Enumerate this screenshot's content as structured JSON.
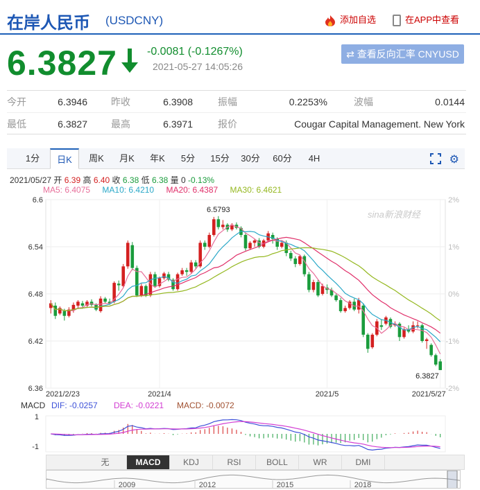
{
  "header": {
    "title": "在岸人民币",
    "code": "(USDCNY)",
    "fav_label": "添加自选",
    "app_label": "在APP中查看"
  },
  "quote": {
    "price": "6.3827",
    "change": "-0.0081 (-0.1267%)",
    "time": "2021-05-27 14:05:26",
    "reverse_label": "查看反向汇率 CNYUSD",
    "direction": "down"
  },
  "stats": {
    "row1": [
      {
        "label": "今开",
        "value": "6.3946"
      },
      {
        "label": "昨收",
        "value": "6.3908"
      },
      {
        "label": "振幅",
        "value": "0.2253%"
      },
      {
        "label": "波幅",
        "value": "0.0144"
      }
    ],
    "row2": [
      {
        "label": "最低",
        "value": "6.3827"
      },
      {
        "label": "最高",
        "value": "6.3971"
      },
      {
        "label": "报价",
        "value": "Cougar Capital Management. New York"
      }
    ]
  },
  "tabs": [
    "1分",
    "日K",
    "周K",
    "月K",
    "年K",
    "5分",
    "15分",
    "30分",
    "60分",
    "4H"
  ],
  "active_tab": "日K",
  "ohlc_line": {
    "date": "2021/05/27",
    "open_label": "开",
    "open": "6.39",
    "high_label": "高",
    "high": "6.40",
    "close_label": "收",
    "close": "6.38",
    "low_label": "低",
    "low": "6.38",
    "vol_label": "量",
    "vol": "0",
    "pct": "-0.13%"
  },
  "ma_line": {
    "ma5": "MA5: 6.4075",
    "ma10": "MA10: 6.4210",
    "ma20": "MA20: 6.4387",
    "ma30": "MA30: 6.4621"
  },
  "colors": {
    "up": "#d42020",
    "down": "#1a9c3c",
    "ma5": "#e86f9a",
    "ma10": "#2aa8c8",
    "ma20": "#e0306a",
    "ma30": "#95b820",
    "dif": "#3c50d8",
    "dea": "#d23cd2",
    "brand": "#1d57b4"
  },
  "watermark": "sina新浪财经",
  "chart_data": {
    "type": "candlestick",
    "y_ticks": [
      "6.6",
      "6.54",
      "6.48",
      "6.42",
      "6.36"
    ],
    "ylim": [
      6.36,
      6.6
    ],
    "pct_ticks": [
      "2%",
      "1%",
      "0%",
      "-1%",
      "-2%"
    ],
    "x_labels": [
      "2021/2/23",
      "2021/4",
      "2021/5",
      "2021/5/27"
    ],
    "max_label": "6.5793",
    "last_label": "6.3827",
    "candles": [
      [
        6.462,
        6.468,
        6.455,
        6.472
      ],
      [
        6.465,
        6.452,
        6.448,
        6.469
      ],
      [
        6.455,
        6.462,
        6.453,
        6.464
      ],
      [
        6.458,
        6.452,
        6.446,
        6.461
      ],
      [
        6.452,
        6.46,
        6.45,
        6.463
      ],
      [
        6.459,
        6.466,
        6.456,
        6.469
      ],
      [
        6.465,
        6.47,
        6.462,
        6.472
      ],
      [
        6.468,
        6.465,
        6.461,
        6.471
      ],
      [
        6.465,
        6.47,
        6.463,
        6.472
      ],
      [
        6.47,
        6.466,
        6.464,
        6.473
      ],
      [
        6.466,
        6.46,
        6.458,
        6.468
      ],
      [
        6.458,
        6.474,
        6.456,
        6.477
      ],
      [
        6.474,
        6.47,
        6.468,
        6.476
      ],
      [
        6.47,
        6.468,
        6.466,
        6.474
      ],
      [
        6.47,
        6.494,
        6.468,
        6.496
      ],
      [
        6.493,
        6.491,
        6.484,
        6.497
      ],
      [
        6.49,
        6.515,
        6.488,
        6.518
      ],
      [
        6.515,
        6.545,
        6.512,
        6.548
      ],
      [
        6.542,
        6.513,
        6.51,
        6.546
      ],
      [
        6.513,
        6.478,
        6.476,
        6.516
      ],
      [
        6.478,
        6.49,
        6.476,
        6.493
      ],
      [
        6.49,
        6.478,
        6.476,
        6.492
      ],
      [
        6.478,
        6.505,
        6.476,
        6.508
      ],
      [
        6.505,
        6.49,
        6.488,
        6.508
      ],
      [
        6.49,
        6.5,
        6.488,
        6.502
      ],
      [
        6.5,
        6.506,
        6.498,
        6.508
      ],
      [
        6.505,
        6.498,
        6.496,
        6.508
      ],
      [
        6.498,
        6.486,
        6.484,
        6.5
      ],
      [
        6.486,
        6.505,
        6.484,
        6.507
      ],
      [
        6.505,
        6.51,
        6.503,
        6.513
      ],
      [
        6.51,
        6.508,
        6.503,
        6.513
      ],
      [
        6.508,
        6.52,
        6.506,
        6.523
      ],
      [
        6.52,
        6.515,
        6.512,
        6.523
      ],
      [
        6.515,
        6.545,
        6.513,
        6.548
      ],
      [
        6.545,
        6.54,
        6.536,
        6.548
      ],
      [
        6.54,
        6.555,
        6.538,
        6.558
      ],
      [
        6.555,
        6.575,
        6.553,
        6.578
      ],
      [
        6.575,
        6.565,
        6.562,
        6.579
      ],
      [
        6.565,
        6.568,
        6.562,
        6.574
      ],
      [
        6.568,
        6.562,
        6.559,
        6.57
      ],
      [
        6.562,
        6.568,
        6.56,
        6.57
      ],
      [
        6.568,
        6.564,
        6.562,
        6.571
      ],
      [
        6.564,
        6.555,
        6.552,
        6.566
      ],
      [
        6.555,
        6.538,
        6.535,
        6.557
      ],
      [
        6.538,
        6.545,
        6.536,
        6.547
      ],
      [
        6.545,
        6.548,
        6.54,
        6.55
      ],
      [
        6.548,
        6.54,
        6.538,
        6.551
      ],
      [
        6.54,
        6.548,
        6.538,
        6.55
      ],
      [
        6.548,
        6.557,
        6.546,
        6.56
      ],
      [
        6.555,
        6.55,
        6.544,
        6.558
      ],
      [
        6.55,
        6.54,
        6.536,
        6.552
      ],
      [
        6.54,
        6.545,
        6.538,
        6.548
      ],
      [
        6.545,
        6.532,
        6.528,
        6.548
      ],
      [
        6.532,
        6.525,
        6.522,
        6.535
      ],
      [
        6.525,
        6.518,
        6.514,
        6.528
      ],
      [
        6.518,
        6.528,
        6.516,
        6.53
      ],
      [
        6.528,
        6.505,
        6.502,
        6.53
      ],
      [
        6.505,
        6.485,
        6.482,
        6.508
      ],
      [
        6.485,
        6.495,
        6.482,
        6.498
      ],
      [
        6.495,
        6.478,
        6.476,
        6.498
      ],
      [
        6.48,
        6.49,
        6.478,
        6.493
      ],
      [
        6.488,
        6.485,
        6.48,
        6.492
      ],
      [
        6.485,
        6.478,
        6.476,
        6.488
      ],
      [
        6.478,
        6.472,
        6.47,
        6.481
      ],
      [
        6.472,
        6.458,
        6.456,
        6.475
      ],
      [
        6.458,
        6.462,
        6.456,
        6.465
      ],
      [
        6.462,
        6.47,
        6.46,
        6.472
      ],
      [
        6.47,
        6.46,
        6.458,
        6.474
      ],
      [
        6.46,
        6.472,
        6.455,
        6.475
      ],
      [
        6.465,
        6.428,
        6.425,
        6.468
      ],
      [
        6.428,
        6.41,
        6.405,
        6.43
      ],
      [
        6.412,
        6.428,
        6.41,
        6.43
      ],
      [
        6.428,
        6.445,
        6.426,
        6.448
      ],
      [
        6.44,
        6.438,
        6.434,
        6.448
      ],
      [
        6.442,
        6.45,
        6.44,
        6.452
      ],
      [
        6.448,
        6.438,
        6.436,
        6.45
      ],
      [
        6.44,
        6.442,
        6.438,
        6.445
      ],
      [
        6.442,
        6.425,
        6.42,
        6.444
      ],
      [
        6.425,
        6.435,
        6.423,
        6.437
      ],
      [
        6.435,
        6.432,
        6.43,
        6.44
      ],
      [
        6.432,
        6.44,
        6.43,
        6.445
      ],
      [
        6.44,
        6.44,
        6.436,
        6.445
      ],
      [
        6.44,
        6.42,
        6.418,
        6.442
      ],
      [
        6.42,
        6.422,
        6.41,
        6.424
      ],
      [
        6.415,
        6.402,
        6.4,
        6.417
      ],
      [
        6.402,
        6.39,
        6.388,
        6.404
      ],
      [
        6.394,
        6.383,
        6.383,
        6.397
      ]
    ],
    "macd": {
      "labels": {
        "name": "MACD",
        "dif": "DIF: -0.0257",
        "dea": "DEA: -0.0221",
        "macd": "MACD: -0.0072"
      },
      "y_ticks": [
        "1",
        "-1"
      ]
    },
    "indicator_tabs": [
      "无",
      "MACD",
      "KDJ",
      "RSI",
      "BOLL",
      "WR",
      "DMI"
    ],
    "active_indicator": "MACD",
    "timeline_labels": [
      "2009",
      "2012",
      "2015",
      "2018"
    ]
  }
}
